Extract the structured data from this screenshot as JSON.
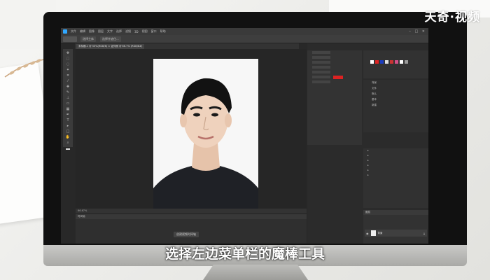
{
  "overlay": {
    "watermark": "天奇·视频",
    "subtitle": "选择左边菜单栏的魔棒工具"
  },
  "photoshop": {
    "menu": [
      "文件",
      "编辑",
      "图像",
      "图层",
      "文字",
      "选择",
      "滤镜",
      "3D",
      "视图",
      "窗口",
      "帮助"
    ],
    "options": [
      "选择主体",
      "选择并遮住..."
    ],
    "doc_tab": "未标题-1 @ 50%(RGB/8) × 证件照 @ 66.7% (RGB/8#)",
    "status": "66.67%",
    "timeline_title": "时间轴",
    "timeline_button": "创建视频时间轴",
    "library_items": [
      "背景",
      "文件",
      "默认",
      "基本",
      "新建"
    ],
    "layer_tab": "图层",
    "layer_name": "背景",
    "accent_red": "#d22222",
    "foreground_color": "#b11111"
  }
}
